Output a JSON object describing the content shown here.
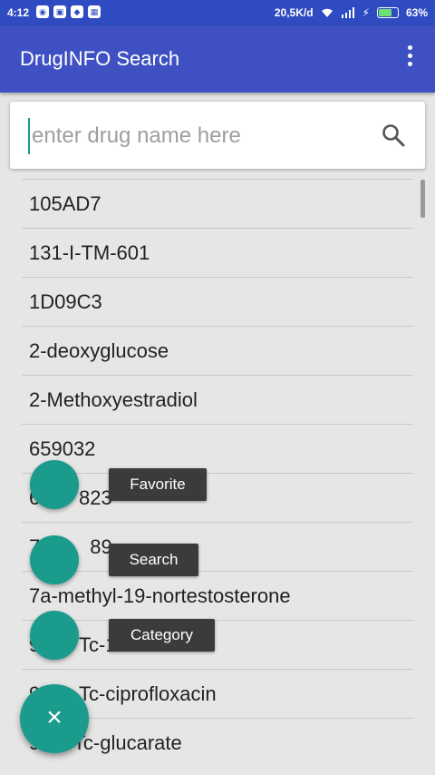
{
  "status_bar": {
    "time": "4:12",
    "net_speed": "20,5K/d",
    "battery": "63%",
    "battery_level": 0.63
  },
  "app_bar": {
    "title": "DrugINFO Search"
  },
  "search": {
    "placeholder": "enter drug name here",
    "value": ""
  },
  "drugs": [
    "105AD7",
    "131-I-TM-601",
    "1D09C3",
    "2-deoxyglucose",
    "2-Methoxyestradiol",
    "659032",
    "6       823",
    "7         89",
    "7a-methyl-19-nortestosterone",
    "9       Tc-14 F 7 Mab",
    "9       Tc-ciprofloxacin",
    "9      Tc-glucarate"
  ],
  "fab_menu": {
    "favorite": "Favorite",
    "search": "Search",
    "category": "Category",
    "close_symbol": "×"
  },
  "colors": {
    "primary": "#3f51c2",
    "accent": "#1a9b8c"
  }
}
